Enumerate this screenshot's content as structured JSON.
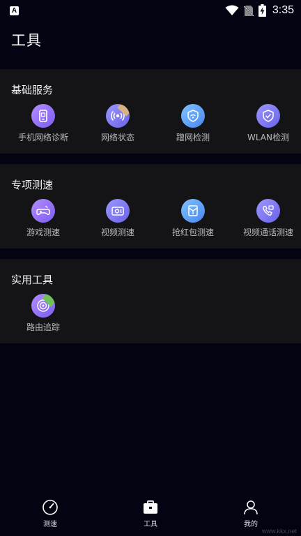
{
  "status_bar": {
    "app_icon_letter": "A",
    "time": "3:35"
  },
  "page_title": "工具",
  "sections": [
    {
      "title": "基础服务",
      "tools": [
        {
          "label": "手机网络诊断",
          "icon": "phone-diagnosis-icon"
        },
        {
          "label": "网络状态",
          "icon": "network-signal-icon"
        },
        {
          "label": "蹭网检测",
          "icon": "wifi-leech-detect-icon"
        },
        {
          "label": "WLAN检测",
          "icon": "wlan-shield-icon"
        }
      ]
    },
    {
      "title": "专项测速",
      "tools": [
        {
          "label": "游戏测速",
          "icon": "gamepad-icon"
        },
        {
          "label": "视频测速",
          "icon": "video-icon"
        },
        {
          "label": "抢红包测速",
          "icon": "red-packet-icon"
        },
        {
          "label": "视频通话测速",
          "icon": "video-call-icon"
        }
      ]
    },
    {
      "title": "实用工具",
      "tools": [
        {
          "label": "路由追踪",
          "icon": "route-trace-icon"
        }
      ]
    }
  ],
  "bottom_nav": [
    {
      "label": "测速",
      "icon": "speedometer-icon"
    },
    {
      "label": "工具",
      "icon": "toolbox-icon"
    },
    {
      "label": "我的",
      "icon": "person-icon"
    }
  ],
  "watermark": "www.kkx.net",
  "colors": {
    "background": "#030412",
    "section_bg": "#141416",
    "accent_purple": "#8b6cf5",
    "accent_blue": "#5a96f2"
  }
}
